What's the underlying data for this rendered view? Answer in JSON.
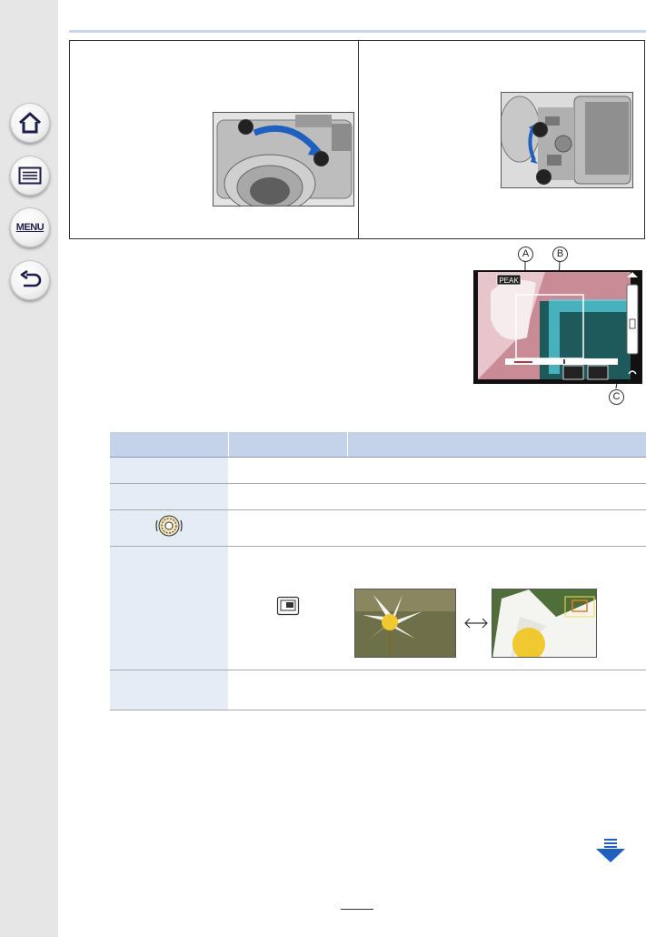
{
  "sidebar": {
    "home_icon": "home-icon",
    "contents_icon": "list-icon",
    "menu_label": "MENU",
    "back_icon": "return-arrow-icon"
  },
  "illustrations": {
    "left": {
      "callouts": [
        "",
        ""
      ]
    },
    "right": {
      "callouts": [
        "",
        ""
      ]
    }
  },
  "screen_figure": {
    "callouts": [
      "A",
      "B",
      "C"
    ],
    "peak_label": "PEAK"
  },
  "table": {
    "rows": 6,
    "dial_icon": "control-dial-icon",
    "pip_icon": "picture-in-picture-icon",
    "swap_icon": "double-arrow-icon"
  },
  "footer": {
    "next_icon": "next-page-arrow-icon"
  },
  "colors": {
    "sidebar_bg": "#e6e6e6",
    "rule": "#c9d6ee",
    "table_header": "#c5d3ea",
    "table_body": "#e6ecf6",
    "accent_blue": "#1f5fbf"
  }
}
